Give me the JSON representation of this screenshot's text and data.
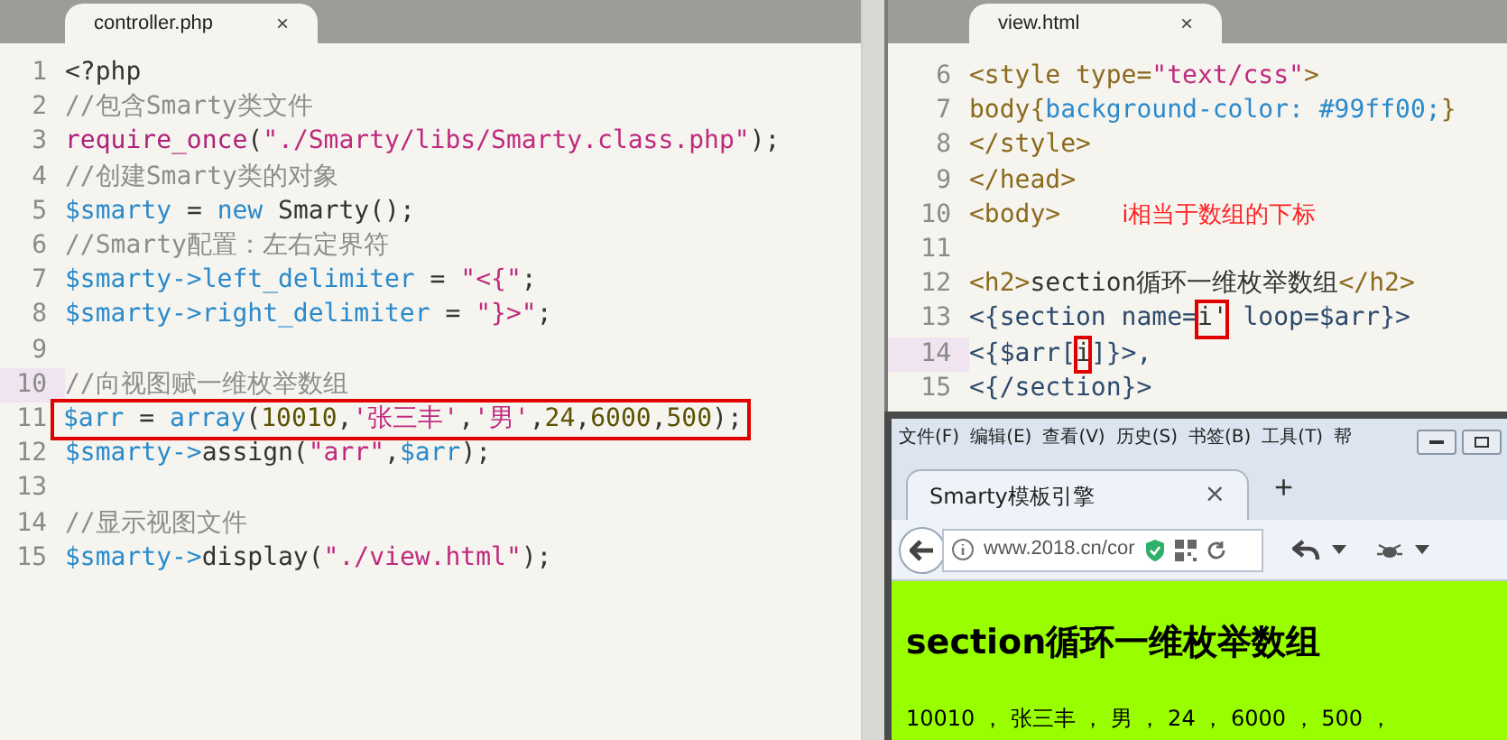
{
  "left_editor": {
    "tab": {
      "title": "controller.php",
      "close": "×"
    },
    "lines": [
      {
        "number": "1",
        "current": false,
        "boxed": false,
        "tokens": [
          {
            "text": "<?php",
            "kind": "plain"
          }
        ]
      },
      {
        "number": "2",
        "current": false,
        "boxed": false,
        "tokens": [
          {
            "text": "//包含Smarty类文件",
            "kind": "comment"
          }
        ]
      },
      {
        "number": "3",
        "current": false,
        "boxed": false,
        "tokens": [
          {
            "text": "require_once",
            "kind": "func"
          },
          {
            "text": "(",
            "kind": "plain"
          },
          {
            "text": "\"./Smarty/libs/Smarty.class.php\"",
            "kind": "string"
          },
          {
            "text": ");",
            "kind": "plain"
          }
        ]
      },
      {
        "number": "4",
        "current": false,
        "boxed": false,
        "tokens": [
          {
            "text": "//创建Smarty类的对象",
            "kind": "comment"
          }
        ]
      },
      {
        "number": "5",
        "current": false,
        "boxed": false,
        "tokens": [
          {
            "text": "$smarty",
            "kind": "var"
          },
          {
            "text": " = ",
            "kind": "plain"
          },
          {
            "text": "new",
            "kind": "var"
          },
          {
            "text": " Smarty();",
            "kind": "plain"
          }
        ]
      },
      {
        "number": "6",
        "current": false,
        "boxed": false,
        "tokens": [
          {
            "text": "//Smarty配置：左右定界符",
            "kind": "comment"
          }
        ]
      },
      {
        "number": "7",
        "current": false,
        "boxed": false,
        "tokens": [
          {
            "text": "$smarty->left_delimiter",
            "kind": "var"
          },
          {
            "text": " = ",
            "kind": "plain"
          },
          {
            "text": "\"<{\"",
            "kind": "string"
          },
          {
            "text": ";",
            "kind": "plain"
          }
        ]
      },
      {
        "number": "8",
        "current": false,
        "boxed": false,
        "tokens": [
          {
            "text": "$smarty->right_delimiter",
            "kind": "var"
          },
          {
            "text": " = ",
            "kind": "plain"
          },
          {
            "text": "\"}>\"",
            "kind": "string"
          },
          {
            "text": ";",
            "kind": "plain"
          }
        ]
      },
      {
        "number": "9",
        "current": false,
        "boxed": false
      },
      {
        "number": "10",
        "current": true,
        "boxed": false,
        "tokens": [
          {
            "text": "//向视图赋一维枚举数组",
            "kind": "comment"
          }
        ]
      },
      {
        "number": "11",
        "current": false,
        "boxed": true,
        "tokens": [
          {
            "text": "$arr",
            "kind": "var"
          },
          {
            "text": " = ",
            "kind": "plain"
          },
          {
            "text": "array",
            "kind": "var"
          },
          {
            "text": "(",
            "kind": "plain"
          },
          {
            "text": "10010",
            "kind": "number"
          },
          {
            "text": ",",
            "kind": "plain"
          },
          {
            "text": "'张三丰'",
            "kind": "string"
          },
          {
            "text": ",",
            "kind": "plain"
          },
          {
            "text": "'男'",
            "kind": "string"
          },
          {
            "text": ",",
            "kind": "plain"
          },
          {
            "text": "24",
            "kind": "number"
          },
          {
            "text": ",",
            "kind": "plain"
          },
          {
            "text": "6000",
            "kind": "number"
          },
          {
            "text": ",",
            "kind": "plain"
          },
          {
            "text": "500",
            "kind": "number"
          },
          {
            "text": ");",
            "kind": "plain"
          }
        ]
      },
      {
        "number": "12",
        "current": false,
        "boxed": false,
        "tokens": [
          {
            "text": "$smarty->",
            "kind": "var"
          },
          {
            "text": "assign(",
            "kind": "plain"
          },
          {
            "text": "\"arr\"",
            "kind": "string"
          },
          {
            "text": ",",
            "kind": "plain"
          },
          {
            "text": "$arr",
            "kind": "var"
          },
          {
            "text": ");",
            "kind": "plain"
          }
        ]
      },
      {
        "number": "13",
        "current": false,
        "boxed": false
      },
      {
        "number": "14",
        "current": false,
        "boxed": false,
        "tokens": [
          {
            "text": "//显示视图文件",
            "kind": "comment"
          }
        ]
      },
      {
        "number": "15",
        "current": false,
        "boxed": false,
        "tokens": [
          {
            "text": "$smarty->",
            "kind": "var"
          },
          {
            "text": "display(",
            "kind": "plain"
          },
          {
            "text": "\"./view.html\"",
            "kind": "string"
          },
          {
            "text": ");",
            "kind": "plain"
          }
        ]
      }
    ]
  },
  "right_editor": {
    "tab": {
      "title": "view.html",
      "close": "×"
    },
    "lines": [
      {
        "number": "6",
        "current": false,
        "tokens": [
          {
            "text": "<style type=",
            "kind": "tag"
          },
          {
            "text": "\"text/css\"",
            "kind": "string"
          },
          {
            "text": ">",
            "kind": "tag"
          }
        ]
      },
      {
        "number": "7",
        "current": false,
        "tokens": [
          {
            "text": "body{",
            "kind": "tag"
          },
          {
            "text": "background-color: #99ff00;",
            "kind": "var"
          },
          {
            "text": "}",
            "kind": "tag"
          }
        ]
      },
      {
        "number": "8",
        "current": false,
        "tokens": [
          {
            "text": "</style>",
            "kind": "tag"
          }
        ]
      },
      {
        "number": "9",
        "current": false,
        "tokens": [
          {
            "text": "</head>",
            "kind": "tag"
          }
        ]
      },
      {
        "number": "10",
        "current": false,
        "tokens": [
          {
            "text": "<body>",
            "kind": "tag"
          },
          {
            "text": "i相当于数组的下标",
            "kind": "note"
          }
        ]
      },
      {
        "number": "11",
        "current": false
      },
      {
        "number": "12",
        "current": false,
        "tokens": [
          {
            "text": "<h2>",
            "kind": "tag"
          },
          {
            "text": "section循环一维枚举数组",
            "kind": "plain"
          },
          {
            "text": "</h2>",
            "kind": "tag"
          }
        ]
      },
      {
        "number": "13",
        "current": false,
        "tokens": [
          {
            "text": "<{section name=",
            "kind": "smarty"
          },
          {
            "text": "i'",
            "kind": "boxed"
          },
          {
            "text": " loop=$arr}>",
            "kind": "smarty"
          }
        ]
      },
      {
        "number": "14",
        "current": true,
        "tokens": [
          {
            "text": "<{$arr[",
            "kind": "smarty"
          },
          {
            "text": "i",
            "kind": "boxed"
          },
          {
            "text": "]}>,",
            "kind": "smarty"
          }
        ]
      },
      {
        "number": "15",
        "current": false,
        "tokens": [
          {
            "text": "<{/section}>",
            "kind": "smarty"
          }
        ]
      }
    ]
  },
  "browser": {
    "menu": [
      "文件(F)",
      "编辑(E)",
      "查看(V)",
      "历史(S)",
      "书签(B)",
      "工具(T)",
      "帮"
    ],
    "tab": {
      "title": "Smarty模板引擎",
      "close": "×"
    },
    "new_tab": "+",
    "address": "www.2018.cn/cor",
    "page": {
      "heading": "section循环一维枚举数组",
      "text": "10010 ， 张三丰 ， 男 ， 24 ， 6000 ， 500 ，"
    }
  }
}
